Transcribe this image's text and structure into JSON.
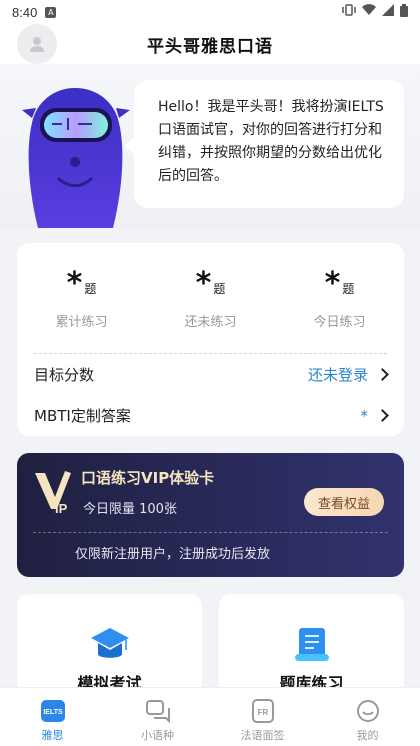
{
  "status_bar": {
    "time": "8:40",
    "badge": "A"
  },
  "header": {
    "title": "平头哥雅思口语"
  },
  "hero": {
    "bubble_text": "Hello！我是平头哥！我将扮演IELTS口语面试官，对你的回答进行打分和纠错，并按照你期望的分数给出优化后的回答。"
  },
  "stats": [
    {
      "value": "*",
      "unit": "题",
      "label": "累计练习"
    },
    {
      "value": "*",
      "unit": "题",
      "label": "还未练习"
    },
    {
      "value": "*",
      "unit": "题",
      "label": "今日练习"
    }
  ],
  "rows": {
    "target": {
      "label": "目标分数",
      "value": "还未登录"
    },
    "mbti": {
      "label": "MBTI定制答案",
      "value": "*"
    }
  },
  "vip": {
    "logo_letter": "V",
    "logo_sub": "IP",
    "title": "口语练习VIP体验卡",
    "limit": "今日限量 100张",
    "button": "查看权益",
    "note": "仅限新注册用户，注册成功后发放"
  },
  "tiles": [
    {
      "label": "模拟考试",
      "icon": "graduation-cap-icon"
    },
    {
      "label": "题库练习",
      "icon": "scroll-icon"
    }
  ],
  "nav": [
    {
      "label": "雅思",
      "icon": "ielts-icon",
      "badge_text": "IELTS",
      "active": true
    },
    {
      "label": "小语种",
      "icon": "chat-bubbles-icon",
      "active": false
    },
    {
      "label": "法语面签",
      "icon": "fr-card-icon",
      "badge_text": "FR",
      "active": false
    },
    {
      "label": "我的",
      "icon": "smile-icon",
      "active": false
    }
  ],
  "colors": {
    "accent": "#2b86c8",
    "vip_bg": "#24254e",
    "vip_gold": "#f6e4c0"
  }
}
